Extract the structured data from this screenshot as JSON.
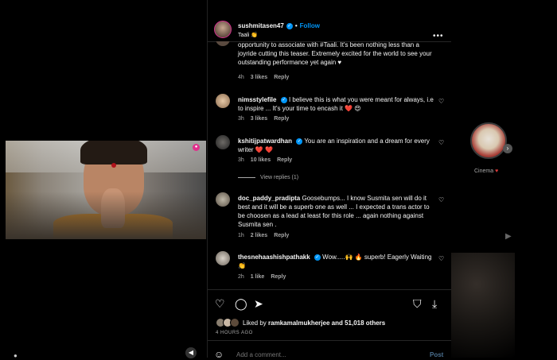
{
  "post": {
    "username": "sushmitasen47",
    "follow_label": "Follow",
    "subtitle": "Taali 👏"
  },
  "first_comment": {
    "text": "opportunity to associate with #Taali. It's been nothing less than a joyride cutting this teaser. Extremely excited for the world to see your outstanding performance yet again ♥",
    "time": "4h",
    "likes": "3 likes",
    "reply": "Reply"
  },
  "comments": [
    {
      "user": "nimsstylefile",
      "text": "I believe this is what you were meant for always, i.e to inspire ... It's your time to encash it ❤️ 😍",
      "time": "3h",
      "likes": "3 likes",
      "reply": "Reply"
    },
    {
      "user": "kshitijpatwardhan",
      "text": "You are an inspiration and a dream for every writer ❤️ ❤️",
      "time": "3h",
      "likes": "10 likes",
      "reply": "Reply",
      "view_replies": "View replies (1)"
    },
    {
      "user": "doc_paddy_pradipta",
      "text": "Goosebumps... I know Susmita sen will do it best and it will be a superb one as well ... I expected a trans actor to be choosen as a lead at least for this role ... again nothing against Susmita sen .",
      "time": "1h",
      "likes": "2 likes",
      "reply": "Reply"
    },
    {
      "user": "thesnehaashishpathakk",
      "text": "Wow.....🙌 🔥 superb! Eagerly Waiting 👏",
      "time": "2h",
      "likes": "1 like",
      "reply": "Reply"
    }
  ],
  "likes_bar": {
    "prefix": "Liked by",
    "liker": "ramkamalmukherjee",
    "suffix": "and 51,018 others"
  },
  "timestamp": "4 HOURS AGO",
  "add_comment": {
    "placeholder": "Add a comment...",
    "post_label": "Post"
  },
  "side": {
    "story_label": "Cinema",
    "story_heart": "♥"
  },
  "colors": {
    "accent": "#0095f6",
    "background": "#000000",
    "muted_text": "#a8a8a8"
  },
  "icons": [
    "heart-icon",
    "comment-icon",
    "share-icon",
    "save-icon",
    "download-icon",
    "emoji-icon",
    "more-icon",
    "audio-icon",
    "verified-icon"
  ]
}
